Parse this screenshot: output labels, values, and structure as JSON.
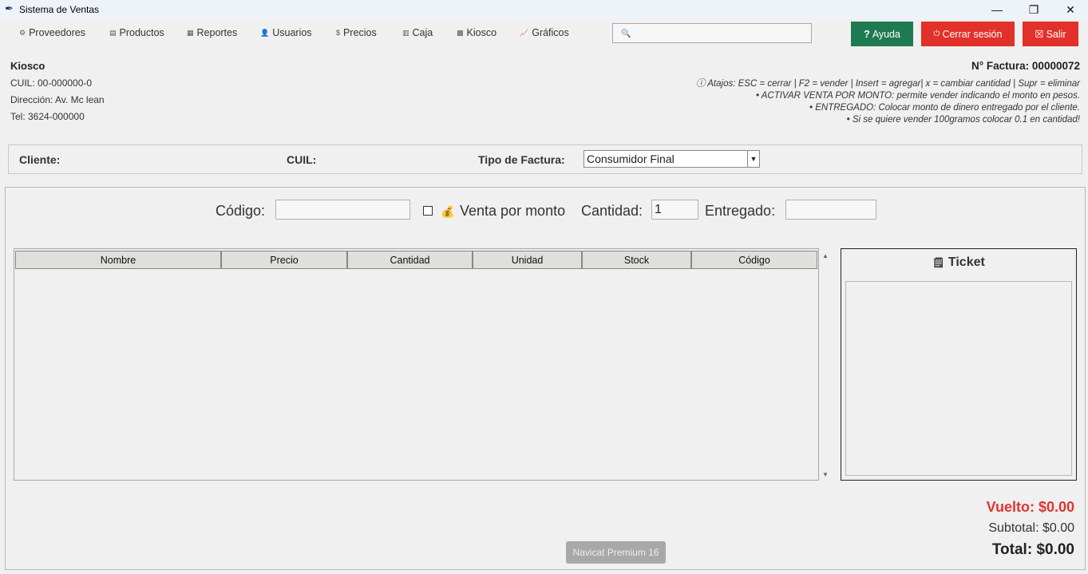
{
  "window": {
    "title": "Sistema de Ventas",
    "app_icon": "feather-icon",
    "minimize_glyph": "—",
    "maximize_glyph": "❐",
    "close_glyph": "✕"
  },
  "menu": {
    "items": [
      {
        "label": "Proveedores",
        "icon": "⚙"
      },
      {
        "label": "Productos",
        "icon": "▤"
      },
      {
        "label": "Reportes",
        "icon": "▦"
      },
      {
        "label": "Usuarios",
        "icon": "👤"
      },
      {
        "label": "Precios",
        "icon": "$"
      },
      {
        "label": "Caja",
        "icon": "▥"
      },
      {
        "label": "Kiosco",
        "icon": "▩"
      },
      {
        "label": "Gráficos",
        "icon": "📈"
      }
    ],
    "search_value": ""
  },
  "actions": {
    "help_label": "Ayuda",
    "help_icon": "?",
    "logout_label": "Cerrar sesión",
    "logout_icon": "⏻",
    "exit_label": "Salir",
    "exit_icon": "☒",
    "help_color": "#1e7a51",
    "danger_color": "#e2302a"
  },
  "store": {
    "name": "Kiosco",
    "cuil": "CUIL: 00-000000-0",
    "address": "Dirección: Av. Mc lean",
    "phone": "Tel: 3624-000000"
  },
  "invoice": {
    "number_text": "N° Factura: 00000072"
  },
  "hints": {
    "line1": "ⓘ Atajos: ESC = cerrar | F2 = vender | Insert = agregar| x = cambiar cantidad  | Supr = eliminar",
    "line2": "• ACTIVAR VENTA POR MONTO: permite vender indicando el monto en pesos.",
    "line3": "• ENTREGADO: Colocar monto de dinero entregado por el cliente.",
    "line4": "• Si se quiere vender 100gramos colocar 0.1 en cantidad!"
  },
  "client": {
    "client_label": "Cliente:",
    "cuil_label": "CUIL:",
    "invoice_type_label": "Tipo de Factura:",
    "invoice_type_value": "Consumidor Final"
  },
  "sale": {
    "code_label": "Código:",
    "code_value": "",
    "amount_sale_label": "Venta por monto",
    "amount_sale_checked": false,
    "amount_sale_icon": "💰",
    "quantity_label": "Cantidad:",
    "quantity_value": "1",
    "delivered_label": "Entregado:",
    "delivered_value": ""
  },
  "table": {
    "columns": [
      "Nombre",
      "Precio",
      "Cantidad",
      "Unidad",
      "Stock",
      "Código"
    ],
    "rows": []
  },
  "ticket": {
    "title": "Ticket",
    "icon": "🗒"
  },
  "totals": {
    "change_text": "Vuelto: $0.00",
    "subtotal_text": "Subtotal: $0.00",
    "total_text": "Total: $0.00",
    "change_color": "#e03530"
  },
  "toast": {
    "text": "Navicat Premium 16"
  }
}
